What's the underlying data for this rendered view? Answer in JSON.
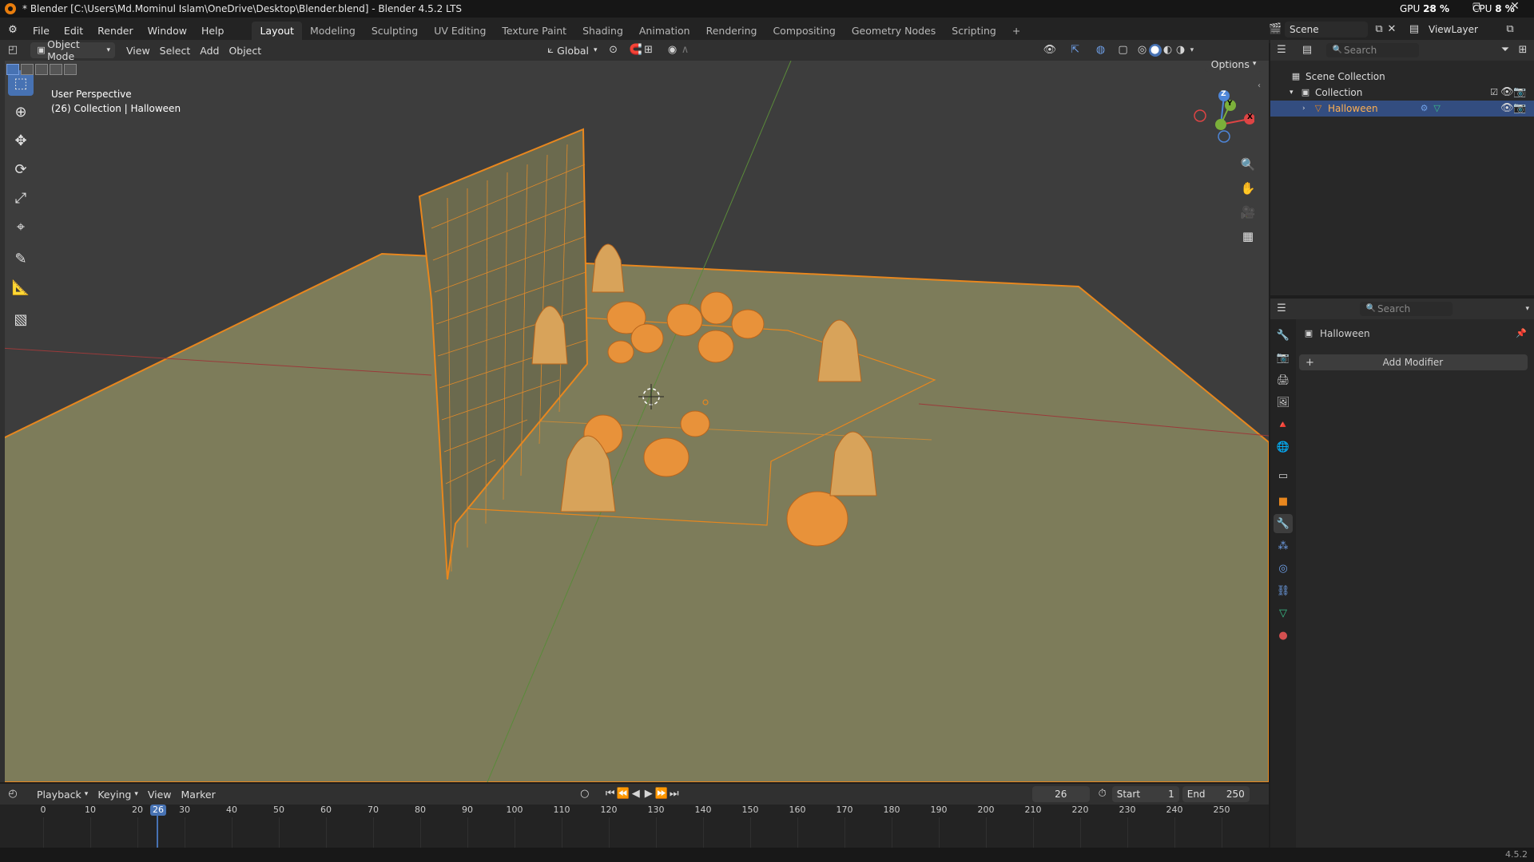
{
  "window": {
    "title": "* Blender [C:\\Users\\Md.Mominul Islam\\OneDrive\\Desktop\\Blender.blend] - Blender 4.5.2 LTS",
    "gpu_label": "GPU",
    "gpu_value": "28 %",
    "cpu_label": "CPU",
    "cpu_value": "8 %"
  },
  "menu": {
    "items": [
      "File",
      "Edit",
      "Render",
      "Window",
      "Help"
    ],
    "workspaces": [
      "Layout",
      "Modeling",
      "Sculpting",
      "UV Editing",
      "Texture Paint",
      "Shading",
      "Animation",
      "Rendering",
      "Compositing",
      "Geometry Nodes",
      "Scripting"
    ],
    "add_tab": "+",
    "scene": "Scene",
    "view_layer": "ViewLayer"
  },
  "viewport_header": {
    "mode": "Object Mode",
    "menus": [
      "View",
      "Select",
      "Add",
      "Object"
    ],
    "orientation": "Global",
    "options": "Options"
  },
  "viewport": {
    "perspective": "User Perspective",
    "collection_info": "(26) Collection | Halloween",
    "axis_x": "X",
    "axis_y": "Y",
    "axis_z": "Z"
  },
  "outliner": {
    "search_placeholder": "Search",
    "scene_collection": "Scene Collection",
    "collection": "Collection",
    "object": "Halloween"
  },
  "properties": {
    "search_placeholder": "Search",
    "object_name": "Halloween",
    "add_modifier": "Add Modifier"
  },
  "timeline": {
    "menus": [
      "Playback",
      "Keying",
      "View",
      "Marker"
    ],
    "current_frame": "26",
    "start_label": "Start",
    "start": "1",
    "end_label": "End",
    "end": "250",
    "ticks": [
      "0",
      "10",
      "20",
      "30",
      "40",
      "50",
      "60",
      "70",
      "80",
      "90",
      "100",
      "110",
      "120",
      "130",
      "140",
      "150",
      "160",
      "170",
      "180",
      "190",
      "200",
      "210",
      "220",
      "230",
      "240",
      "250"
    ],
    "playhead": "26"
  },
  "status": {
    "version": "4.5.2"
  },
  "colors": {
    "accent": "#4772b3",
    "selection": "#e8871e",
    "floor": "#7d7c5a",
    "viewport_bg": "#3d3d3d"
  }
}
